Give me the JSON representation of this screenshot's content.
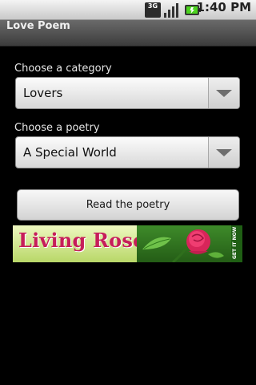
{
  "status_bar": {
    "network_label": "3G",
    "time": "1:40",
    "time_suffix": "PM",
    "icons": [
      "network-3g-icon",
      "signal-strength-icon",
      "battery-icon"
    ]
  },
  "app": {
    "title": "Love Poem"
  },
  "category": {
    "label": "Choose a category",
    "selected": "Lovers"
  },
  "poetry": {
    "label": "Choose a poetry",
    "selected": "A Special World"
  },
  "read_button": {
    "label": "Read the poetry"
  },
  "ad": {
    "headline": "Living Rose",
    "cta": "GET IT NOW",
    "colors": {
      "headline": "#c61e5a",
      "background": "#3e8b2a"
    }
  }
}
